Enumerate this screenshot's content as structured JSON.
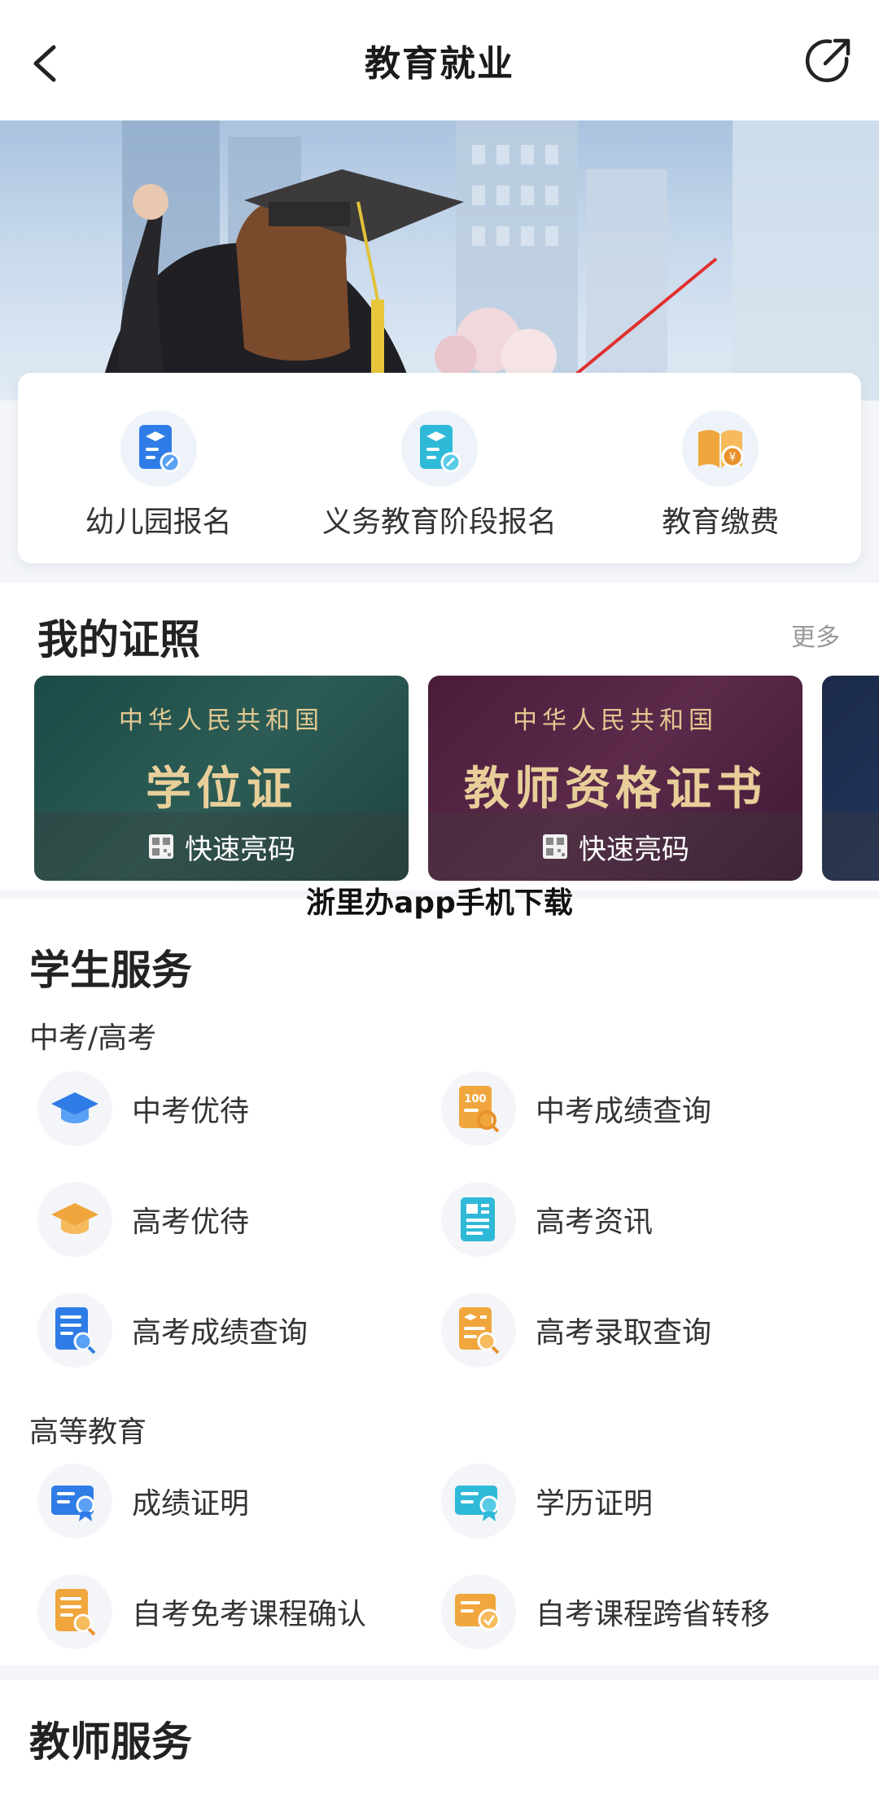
{
  "header": {
    "title": "教育就业",
    "back_icon": "chevron-left-icon",
    "share_icon": "share-external-icon"
  },
  "quick_services": [
    {
      "label": "幼儿园报名",
      "icon": "enroll-doc-icon"
    },
    {
      "label": "义务教育阶段报名",
      "icon": "enroll-doc-icon"
    },
    {
      "label": "教育缴费",
      "icon": "book-yuan-icon"
    }
  ],
  "certificates": {
    "title": "我的证照",
    "more": "更多",
    "cards": [
      {
        "top": "中华人民共和国",
        "main": "学位证",
        "action": "快速亮码"
      },
      {
        "top": "中华人民共和国",
        "main": "教师资格证书",
        "action": "快速亮码"
      }
    ]
  },
  "watermark": "浙里办app手机下载",
  "student_services": {
    "title": "学生服务",
    "groups": [
      {
        "title": "中考/高考",
        "items": [
          {
            "label": "中考优待",
            "icon": "grad-cap-icon"
          },
          {
            "label": "中考成绩查询",
            "icon": "score-search-icon"
          },
          {
            "label": "高考优待",
            "icon": "grad-cap-icon"
          },
          {
            "label": "高考资讯",
            "icon": "news-icon"
          },
          {
            "label": "高考成绩查询",
            "icon": "doc-search-icon"
          },
          {
            "label": "高考录取查询",
            "icon": "admission-search-icon"
          }
        ]
      },
      {
        "title": "高等教育",
        "items": [
          {
            "label": "成绩证明",
            "icon": "certificate-icon"
          },
          {
            "label": "学历证明",
            "icon": "certificate-icon"
          },
          {
            "label": "自考免考课程确认",
            "icon": "doc-search-icon"
          },
          {
            "label": "自考课程跨省转移",
            "icon": "doc-check-icon"
          }
        ]
      }
    ]
  },
  "teacher_services": {
    "title": "教师服务"
  },
  "colors": {
    "blue": "#2f7ce6",
    "orange": "#f0a63c",
    "cyan": "#2fb9d8",
    "gold": "#e3c991"
  }
}
